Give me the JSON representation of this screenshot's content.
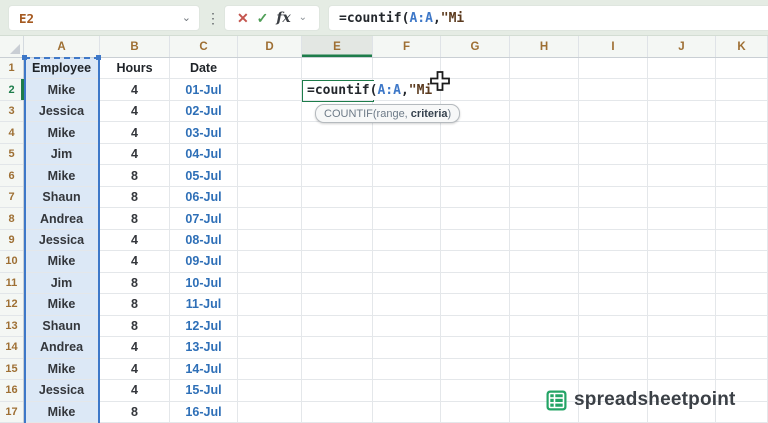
{
  "name_box": {
    "value": "E2"
  },
  "toolbar": {
    "cancel_label": "✕",
    "enter_label": "✓",
    "fx_label": "fx",
    "namebox_chevron": "⌄",
    "fx_chevron": "⌄",
    "dots": "⋮"
  },
  "formula": {
    "p1": "=countif(",
    "ref": "A:A",
    "p2": ",",
    "p3": "\"Mi"
  },
  "tooltip": {
    "fn": "COUNTIF(",
    "arg_done": "range, ",
    "arg_current": "criteria",
    "close": ")"
  },
  "sheet": {
    "columns": [
      "A",
      "B",
      "C",
      "D",
      "E",
      "F",
      "G",
      "H",
      "I",
      "J",
      "K"
    ],
    "active_column": "E",
    "active_row": 2,
    "header_row": {
      "employee": "Employee",
      "hours": "Hours",
      "date": "Date"
    },
    "rows": [
      {
        "n": 2,
        "employee": "Mike",
        "hours": "4",
        "date": "01-Jul"
      },
      {
        "n": 3,
        "employee": "Jessica",
        "hours": "4",
        "date": "02-Jul"
      },
      {
        "n": 4,
        "employee": "Mike",
        "hours": "4",
        "date": "03-Jul"
      },
      {
        "n": 5,
        "employee": "Jim",
        "hours": "4",
        "date": "04-Jul"
      },
      {
        "n": 6,
        "employee": "Mike",
        "hours": "8",
        "date": "05-Jul"
      },
      {
        "n": 7,
        "employee": "Shaun",
        "hours": "8",
        "date": "06-Jul"
      },
      {
        "n": 8,
        "employee": "Andrea",
        "hours": "8",
        "date": "07-Jul"
      },
      {
        "n": 9,
        "employee": "Jessica",
        "hours": "4",
        "date": "08-Jul"
      },
      {
        "n": 10,
        "employee": "Mike",
        "hours": "4",
        "date": "09-Jul"
      },
      {
        "n": 11,
        "employee": "Jim",
        "hours": "8",
        "date": "10-Jul"
      },
      {
        "n": 12,
        "employee": "Mike",
        "hours": "8",
        "date": "11-Jul"
      },
      {
        "n": 13,
        "employee": "Shaun",
        "hours": "8",
        "date": "12-Jul"
      },
      {
        "n": 14,
        "employee": "Andrea",
        "hours": "4",
        "date": "13-Jul"
      },
      {
        "n": 15,
        "employee": "Mike",
        "hours": "4",
        "date": "14-Jul"
      },
      {
        "n": 16,
        "employee": "Jessica",
        "hours": "4",
        "date": "15-Jul"
      },
      {
        "n": 17,
        "employee": "Mike",
        "hours": "8",
        "date": "16-Jul"
      }
    ]
  },
  "watermark": {
    "text": "spreadsheetpoint"
  },
  "colors": {
    "accent_green": "#1d7c4a",
    "range_ref_blue": "#3e78c8",
    "date_blue": "#2e6fb7",
    "column_a_fill": "#dce8f6",
    "header_text_brown": "#9e6f33",
    "logo_green": "#24a466",
    "topbar_bg": "#e5ece4"
  }
}
